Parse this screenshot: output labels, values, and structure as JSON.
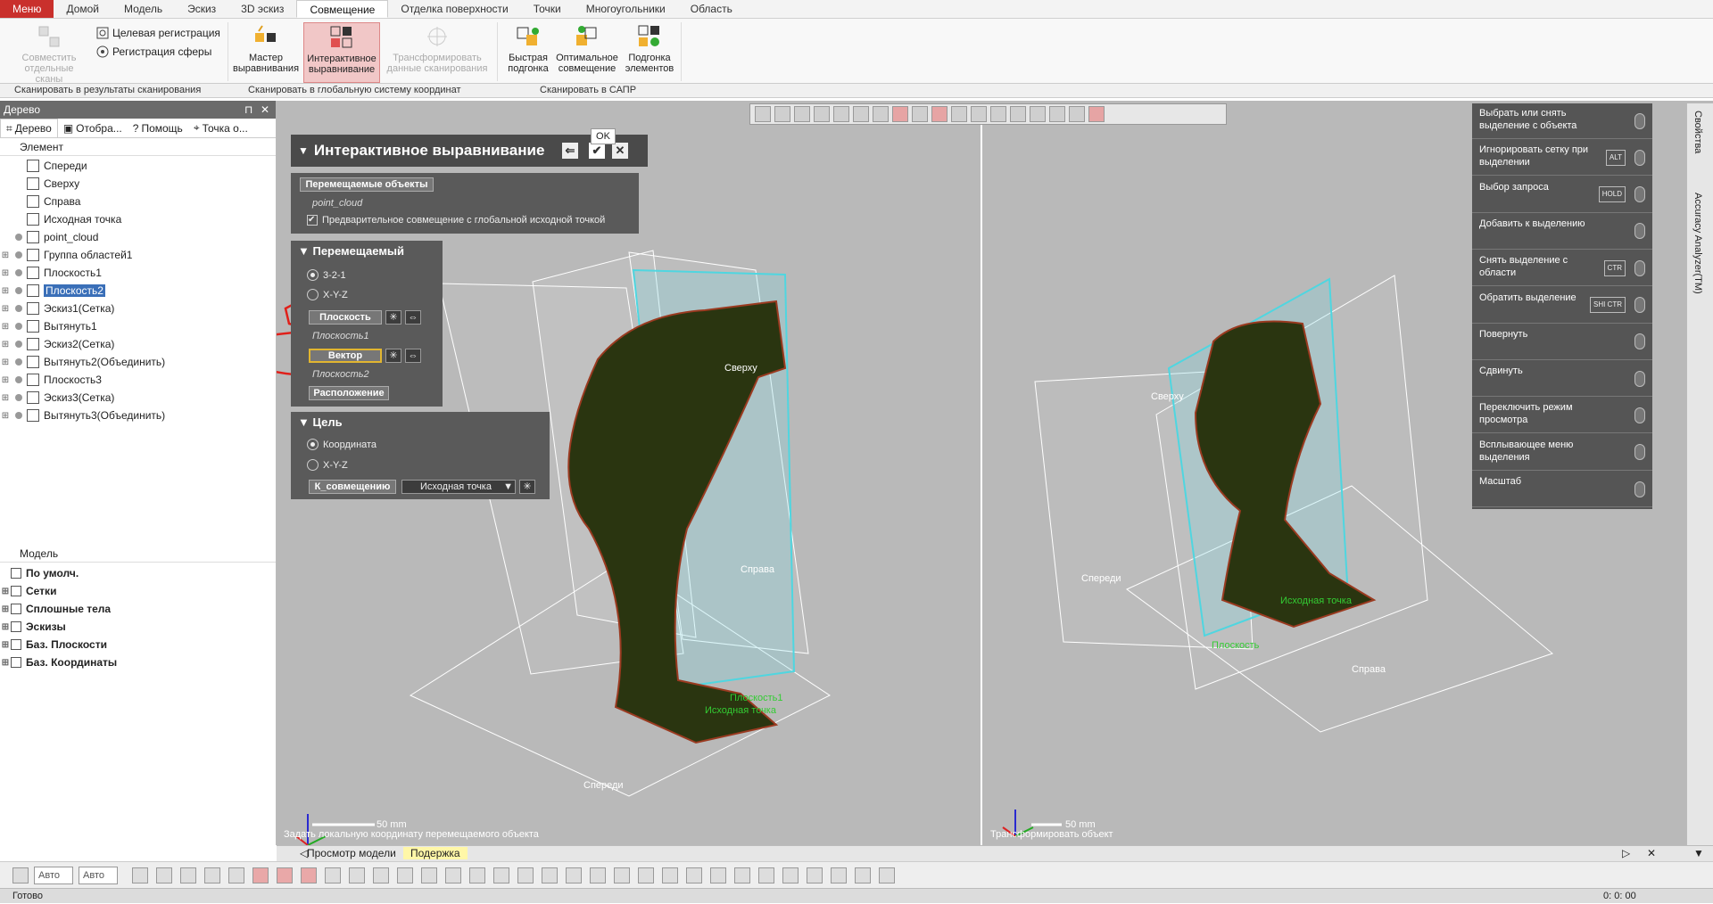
{
  "menubar": {
    "tabs": [
      "Меню",
      "Домой",
      "Модель",
      "Эскиз",
      "3D эскиз",
      "Совмещение",
      "Отделка поверхности",
      "Точки",
      "Многоугольники",
      "Область"
    ],
    "active_index": 5
  },
  "ribbon": {
    "buttons": {
      "combine_scans": "Совместить отдельные сканы",
      "target_registration": "Целевая регистрация",
      "sphere_registration": "Регистрация сферы",
      "align_wizard": "Мастер выравнивания",
      "interactive_align": "Интерактивное выравнивание",
      "transform_scan": "Трансформировать данные сканирования",
      "quick_fit": "Быстрая подгонка",
      "best_fit": "Оптимальное совмещение",
      "fit_elements": "Подгонка элементов"
    },
    "groups": [
      "Сканировать в результаты сканирования",
      "Сканировать в глобальную систему координат",
      "Сканировать в САПР"
    ]
  },
  "tree_panel": {
    "title": "Дерево",
    "tabs": [
      "Дерево",
      "Отобра...",
      "Помощь",
      "Точка о..."
    ],
    "element_header": "Элемент",
    "items": [
      {
        "label": "Спереди",
        "icon": "plane-icon"
      },
      {
        "label": "Сверху",
        "icon": "plane-icon"
      },
      {
        "label": "Справа",
        "icon": "plane-icon"
      },
      {
        "label": "Исходная точка",
        "icon": "origin-icon"
      },
      {
        "label": "point_cloud",
        "icon": "point-cloud-icon"
      },
      {
        "label": "Группа областей1",
        "icon": "region-group-icon"
      },
      {
        "label": "Плоскость1",
        "icon": "plane-icon"
      },
      {
        "label": "Плоскость2",
        "icon": "plane-icon",
        "selected": true
      },
      {
        "label": "Эскиз1(Сетка)",
        "icon": "sketch-icon"
      },
      {
        "label": "Вытянуть1",
        "icon": "extrude-icon"
      },
      {
        "label": "Эскиз2(Сетка)",
        "icon": "sketch-icon"
      },
      {
        "label": "Вытянуть2(Объединить)",
        "icon": "extrude-icon"
      },
      {
        "label": "Плоскость3",
        "icon": "plane-icon"
      },
      {
        "label": "Эскиз3(Сетка)",
        "icon": "sketch-icon"
      },
      {
        "label": "Вытянуть3(Объединить)",
        "icon": "extrude-icon"
      }
    ],
    "model_header": "Модель",
    "model_items": [
      "По умолч.",
      "Сетки",
      "Сплошные тела",
      "Эскизы",
      "Баз. Плоскости",
      "Баз. Координаты"
    ]
  },
  "interactive_panel": {
    "title": "Интерактивное выравнивание",
    "ok_tooltip": "OK",
    "movable_objects_label": "Перемещаемые объекты",
    "movable_object_value": "point_cloud",
    "prealign_checkbox": "Предварительное совмещение с глобальной исходной точкой",
    "moving_title": "Перемещаемый",
    "moving_options": [
      "3-2-1",
      "X-Y-Z"
    ],
    "plane_button": "Плоскость",
    "plane_value": "Плоскость1",
    "vector_button": "Вектор",
    "vector_value": "Плоскость2",
    "position_button": "Расположение",
    "target_title": "Цель",
    "target_options": [
      "Координата",
      "X-Y-Z"
    ],
    "to_align_button": "К_совмещению",
    "origin_select": "Исходная точка"
  },
  "viewport": {
    "left_labels": {
      "top": "Сверху",
      "right": "Справа",
      "front": "Спереди",
      "origin": "Исходная точка",
      "plane": "Плоскость1"
    },
    "right_labels": {
      "top": "Сверху",
      "right": "Справа",
      "front": "Спереди",
      "plane": "Плоскость",
      "origin": "Исходная точка"
    },
    "scale": "50 mm",
    "left_hint": "Задать локальную координату перемещаемого объекта",
    "right_hint": "Трансформировать объект"
  },
  "right_panel": {
    "items": [
      {
        "label": "Выбрать или снять выделение с объекта",
        "key": ""
      },
      {
        "label": "Игнорировать сетку при выделении",
        "key": "ALT"
      },
      {
        "label": "Выбор запроса",
        "key": "HOLD"
      },
      {
        "label": "Добавить к выделению",
        "key": ""
      },
      {
        "label": "Снять выделение с области",
        "key": "CTR"
      },
      {
        "label": "Обратить выделение",
        "key": "SHI CTR"
      },
      {
        "label": "Повернуть",
        "key": ""
      },
      {
        "label": "Сдвинуть",
        "key": ""
      },
      {
        "label": "Переключить режим просмотра",
        "key": ""
      },
      {
        "label": "Всплывающее меню выделения",
        "key": ""
      },
      {
        "label": "Масштаб",
        "key": ""
      }
    ]
  },
  "side_tabs": [
    "Свойства",
    "Accuracy Analyzer(TM)"
  ],
  "view_tabs": [
    "Просмотр модели",
    "Подержка"
  ],
  "bottom_toolbar": {
    "select1": "Авто",
    "select2": "Авто"
  },
  "status": {
    "text": "Готово",
    "time": "0: 0: 00"
  },
  "colors": {
    "menu_red": "#c9302c",
    "panel_dark": "#4a4a4a",
    "viewport_bg": "#b9b9b9",
    "selection_blue": "#3a6fb8",
    "annotation_red": "#e0201a"
  }
}
